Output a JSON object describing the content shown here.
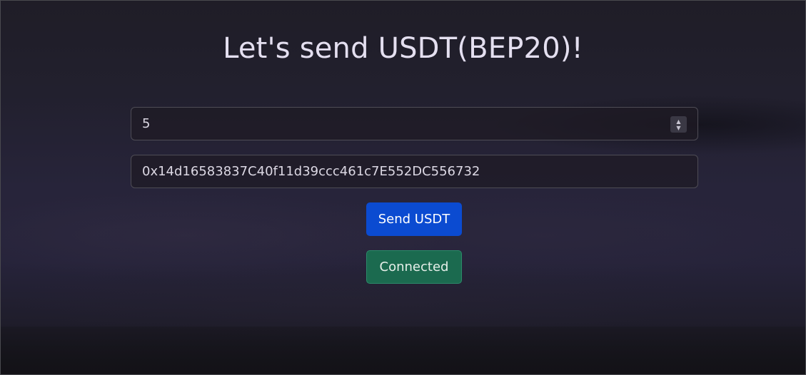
{
  "page": {
    "title": "Let's send USDT(BEP20)!"
  },
  "form": {
    "amount_value": "5",
    "address_value": "0x14d16583837C40f11d39ccc461c7E552DC556732"
  },
  "buttons": {
    "send_label": "Send USDT",
    "status_label": "Connected"
  },
  "icons": {
    "spinner_up": "chevron-up-icon",
    "spinner_down": "chevron-down-icon"
  },
  "colors": {
    "send_button": "#0b4bd1",
    "connected_button": "#1b6a4f"
  }
}
